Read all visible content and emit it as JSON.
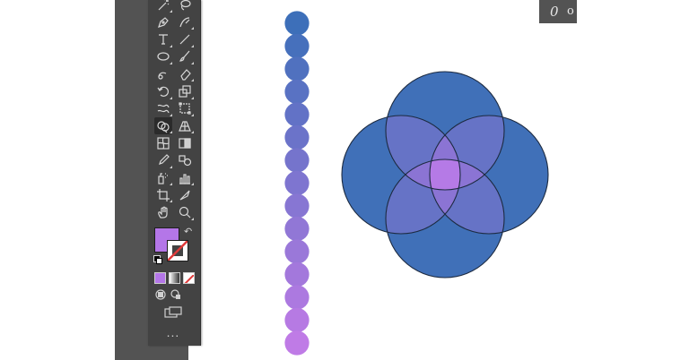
{
  "app": {
    "panel_glyphs": [
      "0",
      "o"
    ]
  },
  "toolbar": {
    "tools": [
      {
        "name": "magic-wand-icon",
        "col": 0,
        "row": 0
      },
      {
        "name": "lasso-icon",
        "col": 1,
        "row": 0
      },
      {
        "name": "pen-icon",
        "col": 0,
        "row": 1
      },
      {
        "name": "curvature-icon",
        "col": 1,
        "row": 1
      },
      {
        "name": "type-icon",
        "col": 0,
        "row": 2
      },
      {
        "name": "line-segment-icon",
        "col": 1,
        "row": 2
      },
      {
        "name": "ellipse-icon",
        "col": 0,
        "row": 3
      },
      {
        "name": "paintbrush-icon",
        "col": 1,
        "row": 3
      },
      {
        "name": "shaper-icon",
        "col": 0,
        "row": 4
      },
      {
        "name": "eraser-icon",
        "col": 1,
        "row": 4
      },
      {
        "name": "rotate-icon",
        "col": 0,
        "row": 5
      },
      {
        "name": "scale-icon",
        "col": 1,
        "row": 5
      },
      {
        "name": "warp-icon",
        "col": 0,
        "row": 6
      },
      {
        "name": "free-transform-icon",
        "col": 1,
        "row": 6
      },
      {
        "name": "shape-builder-icon",
        "col": 0,
        "row": 7,
        "active": true
      },
      {
        "name": "perspective-grid-icon",
        "col": 1,
        "row": 7
      },
      {
        "name": "mesh-icon",
        "col": 0,
        "row": 8
      },
      {
        "name": "gradient-icon",
        "col": 1,
        "row": 8
      },
      {
        "name": "eyedropper-icon",
        "col": 0,
        "row": 9
      },
      {
        "name": "blend-icon",
        "col": 1,
        "row": 9
      },
      {
        "name": "symbol-sprayer-icon",
        "col": 0,
        "row": 10
      },
      {
        "name": "column-graph-icon",
        "col": 1,
        "row": 10
      },
      {
        "name": "artboard-icon",
        "col": 0,
        "row": 11
      },
      {
        "name": "slice-icon",
        "col": 1,
        "row": 11
      },
      {
        "name": "hand-icon",
        "col": 0,
        "row": 12
      },
      {
        "name": "zoom-icon",
        "col": 1,
        "row": 12
      }
    ],
    "fill_color": "#b476e8",
    "stroke_color": "#ffffff",
    "more_label": "..."
  },
  "canvas": {
    "dot_count": 15,
    "dot_start_color": "#3d6fb9",
    "dot_end_color": "#bf7be6",
    "venn": {
      "outer_color": "#4070b8",
      "overlap2_color": "#6673c6",
      "overlap3_color": "#8b74d4",
      "center_color": "#b57ae6",
      "stroke_color": "#1c2a40"
    }
  }
}
